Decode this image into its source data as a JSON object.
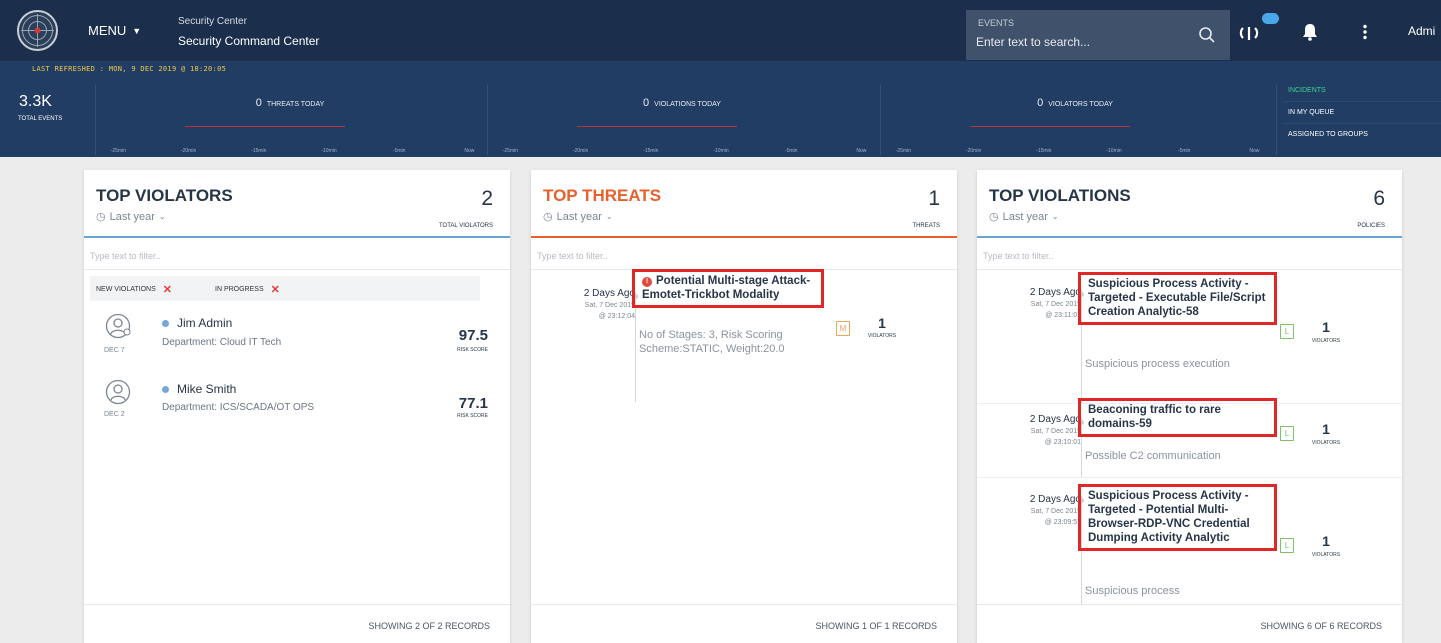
{
  "header": {
    "menu_label": "MENU",
    "app_subtitle": "Security Center",
    "app_title": "Security Command Center",
    "search": {
      "label": "EVENTS",
      "placeholder": "Enter text to search..."
    },
    "user_name": "Admi"
  },
  "stats": {
    "last_refreshed": "LAST REFRESHED : MON, 9 DEC 2019 @ 18:20:05",
    "total_events_value": "3.3K",
    "total_events_label": "TOTAL EVENTS",
    "segments": [
      {
        "value": "0",
        "label": "THREATS TODAY",
        "ticks": [
          "-25min",
          "-20min",
          "-15min",
          "-10min",
          "-5min",
          "Now"
        ]
      },
      {
        "value": "0",
        "label": "VIOLATIONS TODAY",
        "ticks": [
          "-25min",
          "-20min",
          "-15min",
          "-10min",
          "-5min",
          "Now"
        ]
      },
      {
        "value": "0",
        "label": "VIOLATORS TODAY",
        "ticks": [
          "-25min",
          "-20min",
          "-15min",
          "-10min",
          "-5min",
          "Now"
        ]
      }
    ],
    "incidents": {
      "title": "INCIDENTS",
      "items": [
        "IN MY QUEUE",
        "ASSIGNED TO GROUPS"
      ]
    }
  },
  "cards": {
    "violators": {
      "title": "TOP VIOLATORS",
      "period": "Last year",
      "count": "2",
      "count_label": "TOTAL VIOLATORS",
      "filter_placeholder": "Type text to filter..",
      "chips": [
        "NEW VIOLATIONS",
        "IN PROGRESS"
      ],
      "rows": [
        {
          "date": "DEC 7",
          "name": "Jim Admin",
          "department": "Department: Cloud IT Tech",
          "score": "97.5",
          "score_label": "RISK SCORE"
        },
        {
          "date": "DEC 2",
          "name": "Mike Smith",
          "department": "Department: ICS/SCADA/OT OPS",
          "score": "77.1",
          "score_label": "RISK SCORE"
        }
      ],
      "footer": "SHOWING 2 OF 2 RECORDS"
    },
    "threats": {
      "title": "TOP THREATS",
      "period": "Last year",
      "count": "1",
      "count_label": "THREATS",
      "filter_placeholder": "Type text to filter..",
      "rows": [
        {
          "ago": "2 Days Ago",
          "date": "Sat, 7 Dec 2019",
          "time": "@ 23:12:04",
          "title": "Potential Multi-stage Attack-Emotet-Trickbot Modality",
          "description": "No of Stages: 3, Risk Scoring Scheme:STATIC, Weight:20.0",
          "severity": "M",
          "violators": "1",
          "violators_label": "VIOLATORS"
        }
      ],
      "footer": "SHOWING 1 OF 1 RECORDS"
    },
    "violations": {
      "title": "TOP VIOLATIONS",
      "period": "Last year",
      "count": "6",
      "count_label": "POLICIES",
      "filter_placeholder": "Type text to filter..",
      "rows": [
        {
          "ago": "2 Days Ago",
          "date": "Sat, 7 Dec 2019",
          "time": "@ 23:11:07",
          "title": "Suspicious Process Activity - Targeted - Executable File/Script Creation Analytic-58",
          "description": "Suspicious process execution",
          "severity": "L",
          "violators": "1",
          "violators_label": "VIOLATORS"
        },
        {
          "ago": "2 Days Ago",
          "date": "Sat, 7 Dec 2019",
          "time": "@ 23:10:01",
          "title": "Beaconing traffic to rare domains-59",
          "description": "Possible C2 communication",
          "severity": "L",
          "violators": "1",
          "violators_label": "VIOLATORS"
        },
        {
          "ago": "2 Days Ago",
          "date": "Sat, 7 Dec 2019",
          "time": "@ 23:09:57",
          "title": "Suspicious Process Activity - Targeted - Potential Multi-Browser-RDP-VNC Credential Dumping Activity Analytic",
          "description": "Suspicious process",
          "severity": "L",
          "violators": "1",
          "violators_label": "VIOLATORS"
        }
      ],
      "footer": "SHOWING 6 OF 6 RECORDS"
    }
  },
  "colors": {
    "header_bg": "#1b2f4d",
    "strip_bg": "#223d64",
    "threat_accent": "#e8612c",
    "violator_accent": "#6aa4d2",
    "highlight_border": "#df2727",
    "severity_medium": "#eaa55a",
    "severity_low": "#7dc06e"
  },
  "icons": [
    "radar-logo-icon",
    "chevron-down-icon",
    "search-icon",
    "cloud-connector-icon",
    "bell-icon",
    "more-vertical-icon",
    "history-icon",
    "user-avatar-icon",
    "alert-icon",
    "close-icon"
  ]
}
